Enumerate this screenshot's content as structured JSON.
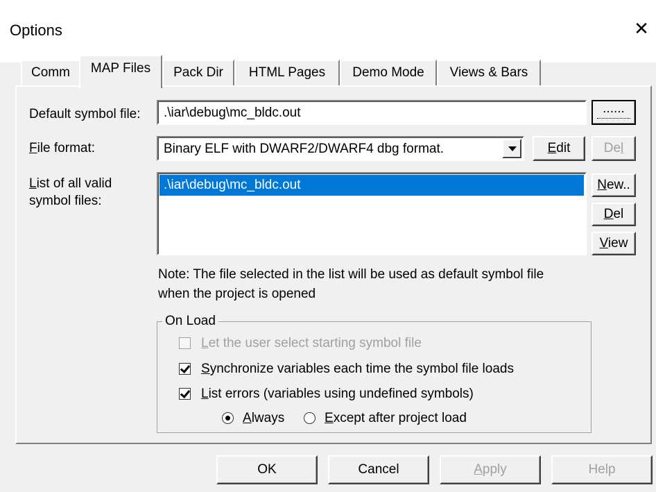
{
  "window": {
    "title": "Options"
  },
  "tabs": [
    {
      "label": "Comm"
    },
    {
      "label": "MAP Files"
    },
    {
      "label": "Pack Dir"
    },
    {
      "label": "HTML Pages"
    },
    {
      "label": "Demo Mode"
    },
    {
      "label": "Views & Bars"
    }
  ],
  "active_tab": "MAP Files",
  "map_files": {
    "default_symbol_label": "Default symbol file:",
    "default_symbol_value": ".\\iar\\debug\\mc_bldc.out",
    "browse_label": "......",
    "file_format_label": "File format:",
    "file_format_value": "Binary ELF with DWARF2/DWARF4 dbg format.",
    "edit_label": "Edit",
    "del_format_label": "Del",
    "list_label_line1": "List of all valid",
    "list_label_line2": "symbol files:",
    "list_items": [
      ".\\iar\\debug\\mc_bldc.out"
    ],
    "new_label": "New..",
    "del_label": "Del",
    "view_label": "View",
    "note_line1": "Note: The file selected in the list will be used as default symbol file",
    "note_line2": "when the project is opened",
    "on_load": {
      "title": "On Load",
      "let_user_select": "Let the user select starting symbol file",
      "synchronize": "Synchronize variables each time the symbol file loads",
      "list_errors": "List errors (variables using undefined symbols)",
      "always": "Always",
      "except_after": "Except after project load",
      "let_user_select_checked": false,
      "synchronize_checked": true,
      "list_errors_checked": true,
      "selected_radio": "Always"
    }
  },
  "buttons": {
    "ok": "OK",
    "cancel": "Cancel",
    "apply": "Apply",
    "help": "Help"
  }
}
